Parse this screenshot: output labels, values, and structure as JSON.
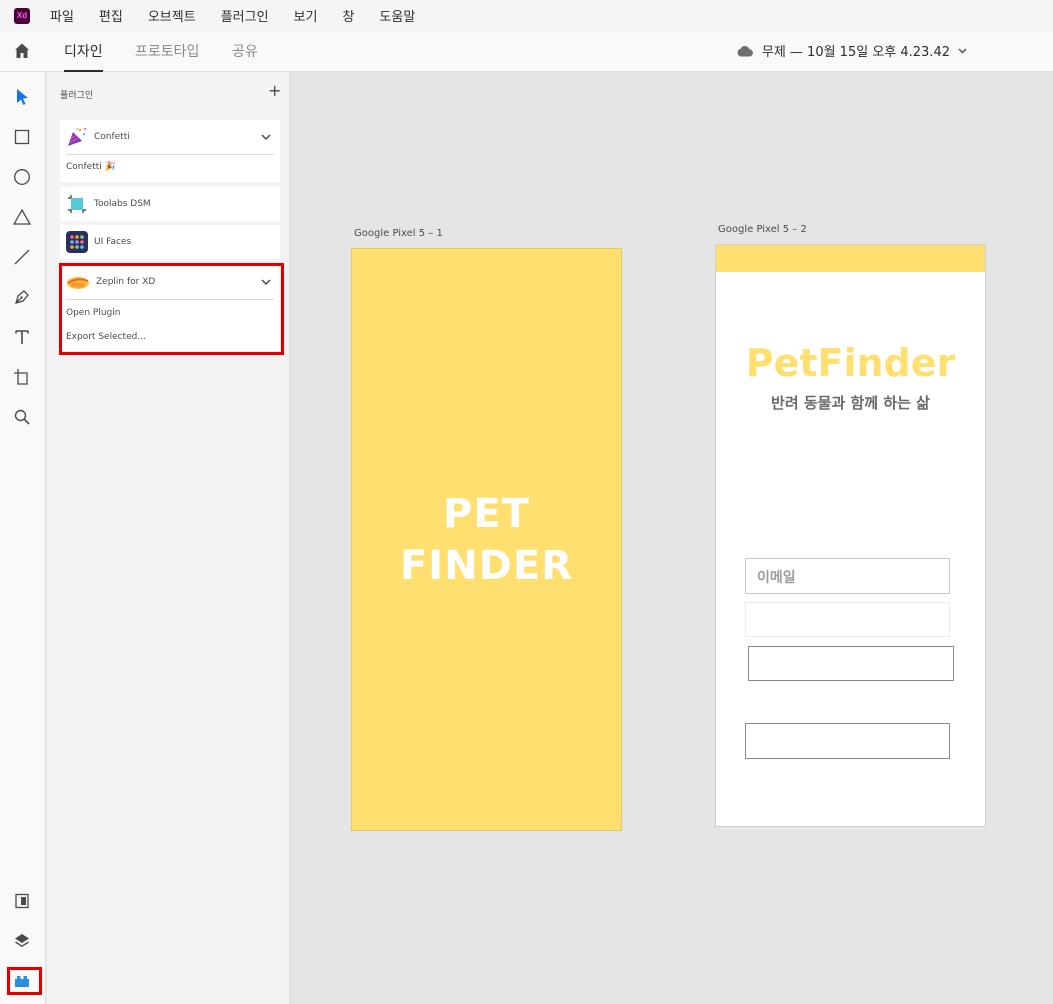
{
  "app": {
    "logo_text": "Xd"
  },
  "menu": [
    "파일",
    "편집",
    "오브젝트",
    "플러그인",
    "보기",
    "창",
    "도움말"
  ],
  "tabs": {
    "design": "디자인",
    "prototype": "프로토타입",
    "share": "공유"
  },
  "document_status": "무제 — 10월 15일 오후 4.23.42",
  "panel": {
    "title": "플러그인",
    "plugins": [
      {
        "name": "Confetti",
        "expanded": true,
        "commands": [
          "Confetti 🎉"
        ]
      },
      {
        "name": "Toolabs DSM",
        "expanded": false
      },
      {
        "name": "UI Faces",
        "expanded": false
      },
      {
        "name": "Zeplin for XD",
        "expanded": true,
        "commands": [
          "Open Plugin",
          "Export Selected..."
        ]
      }
    ]
  },
  "artboards": [
    {
      "label": "Google Pixel 5 – 1",
      "title_line1": "PET",
      "title_line2": "FINDER",
      "color": "#ffdf6f"
    },
    {
      "label": "Google Pixel 5 – 2",
      "logo": "PetFinder",
      "subtitle": "반려 동물과 함께 하는 삶",
      "email_placeholder": "이메일"
    }
  ],
  "colors": {
    "accent_yellow": "#ffdf6f",
    "highlight_red": "#e00000",
    "selected_tool_blue": "#1473e6"
  },
  "icons": {
    "toolbar": [
      "select-icon",
      "rectangle-icon",
      "ellipse-icon",
      "polygon-icon",
      "line-icon",
      "pen-icon",
      "text-icon",
      "artboard-icon",
      "zoom-icon"
    ],
    "toolbar_bottom": [
      "assets-icon",
      "layers-icon",
      "plugins-icon"
    ]
  }
}
